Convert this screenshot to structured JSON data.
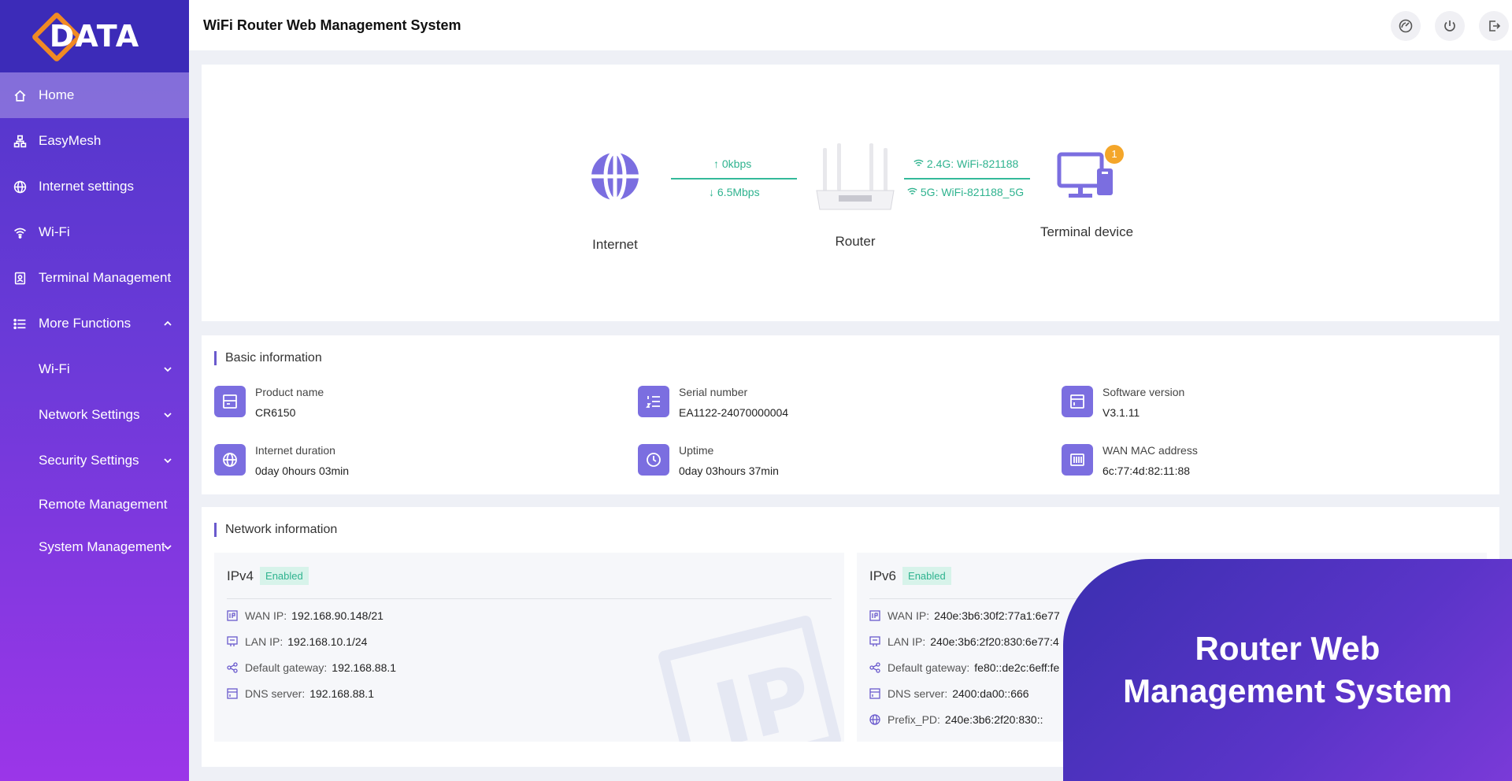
{
  "logo": {
    "text": "DATA"
  },
  "header": {
    "title": "WiFi Router Web Management System"
  },
  "sidebar": {
    "items": [
      {
        "label": "Home",
        "active": true,
        "icon": "home-icon"
      },
      {
        "label": "EasyMesh",
        "icon": "mesh-icon"
      },
      {
        "label": "Internet settings",
        "icon": "globe-icon"
      },
      {
        "label": "Wi-Fi",
        "icon": "wifi-icon"
      },
      {
        "label": "Terminal Management",
        "icon": "terminal-icon"
      },
      {
        "label": "More Functions",
        "icon": "list-icon",
        "expanded": true
      }
    ],
    "sub_items": [
      {
        "label": "Wi-Fi"
      },
      {
        "label": "Network Settings"
      },
      {
        "label": "Security Settings"
      },
      {
        "label": "Remote Management"
      },
      {
        "label": "System Management"
      }
    ]
  },
  "topology": {
    "internet_label": "Internet",
    "router_label": "Router",
    "terminal_label": "Terminal device",
    "terminal_count": "1",
    "upload": "0kbps",
    "download": "6.5Mbps",
    "ssid_24": "2.4G: WiFi-821188",
    "ssid_5": "5G: WiFi-821188_5G",
    "link_color": "#33b99a"
  },
  "basic": {
    "title": "Basic information",
    "product_name_label": "Product name",
    "product_name": "CR6150",
    "serial_label": "Serial number",
    "serial": "EA1122-24070000004",
    "software_label": "Software version",
    "software": "V3.1.11",
    "internet_duration_label": "Internet duration",
    "internet_duration": "0day 0hours 03min",
    "uptime_label": "Uptime",
    "uptime": "0day 03hours 37min",
    "wan_mac_label": "WAN MAC address",
    "wan_mac": "6c:77:4d:82:11:88"
  },
  "network": {
    "title": "Network information",
    "ipv4": {
      "title": "IPv4",
      "status": "Enabled",
      "wan_ip_label": "WAN IP:",
      "wan_ip": "192.168.90.148/21",
      "lan_ip_label": "LAN IP:",
      "lan_ip": "192.168.10.1/24",
      "gateway_label": "Default gateway:",
      "gateway": "192.168.88.1",
      "dns_label": "DNS server:",
      "dns": "192.168.88.1"
    },
    "ipv6": {
      "title": "IPv6",
      "status": "Enabled",
      "wan_ip_label": "WAN IP:",
      "wan_ip": "240e:3b6:30f2:77a1:6e77",
      "lan_ip_label": "LAN IP:",
      "lan_ip": "240e:3b6:2f20:830:6e77:4",
      "gateway_label": "Default gateway:",
      "gateway": "fe80::de2c:6eff:fe",
      "dns_label": "DNS server:",
      "dns": "2400:da00::666",
      "prefix_label": "Prefix_PD:",
      "prefix": "240e:3b6:2f20:830::"
    }
  },
  "promo": {
    "text": "Router Web Management System"
  },
  "colors": {
    "accent": "#6a5acd",
    "sidebar_top": "#4e35c8",
    "sidebar_bottom": "#9b36e8",
    "badge_green": "#2fb38f"
  }
}
